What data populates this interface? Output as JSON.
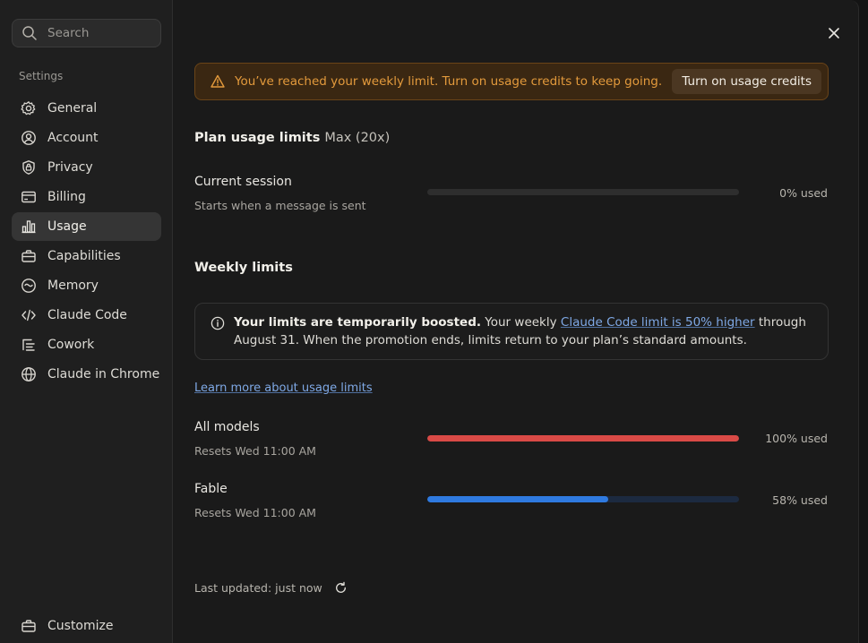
{
  "sidebar": {
    "search_placeholder": "Search",
    "section_label": "Settings",
    "items": [
      {
        "label": "General",
        "icon": "gear-icon"
      },
      {
        "label": "Account",
        "icon": "user-circle-icon"
      },
      {
        "label": "Privacy",
        "icon": "shield-lock-icon"
      },
      {
        "label": "Billing",
        "icon": "card-icon"
      },
      {
        "label": "Usage",
        "icon": "bar-chart-icon",
        "active": true
      },
      {
        "label": "Capabilities",
        "icon": "toolbox-icon"
      },
      {
        "label": "Memory",
        "icon": "memory-icon"
      },
      {
        "label": "Claude Code",
        "icon": "code-icon"
      },
      {
        "label": "Cowork",
        "icon": "cowork-icon"
      },
      {
        "label": "Claude in Chrome",
        "icon": "globe-icon"
      }
    ],
    "customize_label": "Customize"
  },
  "alert": {
    "text": "You’ve reached your weekly limit. Turn on usage credits to keep going.",
    "button_label": "Turn on usage credits"
  },
  "plan": {
    "title": "Plan usage limits",
    "tier": "Max (20x)"
  },
  "current_session": {
    "label": "Current session",
    "sub": "Starts when a message is sent",
    "used_fraction": 0,
    "pct_label": "0% used"
  },
  "weekly": {
    "title": "Weekly limits",
    "info_bold": "Your limits are temporarily boosted.",
    "info_pre": " Your weekly ",
    "info_link": "Claude Code limit is 50% higher",
    "info_post": " through August 31. When the promotion ends, limits return to your plan’s standard amounts.",
    "learn_more": "Learn more about usage limits",
    "rows": [
      {
        "label": "All models",
        "sub": "Resets Wed 11:00 AM",
        "used_fraction": 1.0,
        "pct_label": "100% used",
        "color": "#d94a46"
      },
      {
        "label": "Fable",
        "sub": "Resets Wed 11:00 AM",
        "used_fraction": 0.58,
        "pct_label": "58% used",
        "color": "#2f7ae0"
      }
    ]
  },
  "footer": {
    "last_updated": "Last updated: just now"
  },
  "colors": {
    "accent_blue": "#2f7ae0",
    "limit_red": "#d94a46",
    "warning_orange": "#e39a3c"
  }
}
